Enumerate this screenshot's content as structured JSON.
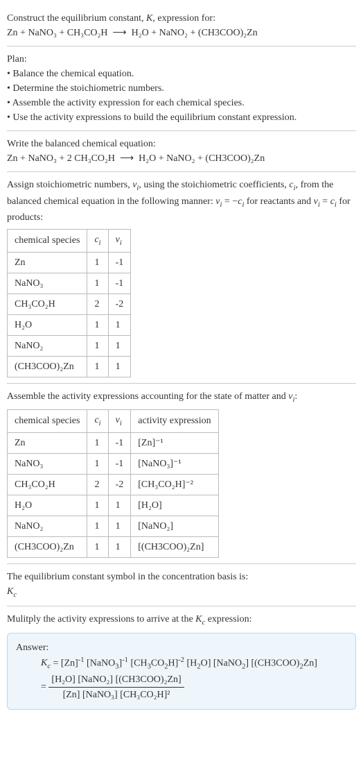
{
  "header": {
    "title_line1": "Construct the equilibrium constant, K, expression for:",
    "equation": "Zn + NaNO₃ + CH₃CO₂H  ⟶  H₂O + NaNO₂ + (CH3COO)₂Zn"
  },
  "plan": {
    "heading": "Plan:",
    "items": [
      "• Balance the chemical equation.",
      "• Determine the stoichiometric numbers.",
      "• Assemble the activity expression for each chemical species.",
      "• Use the activity expressions to build the equilibrium constant expression."
    ]
  },
  "balanced": {
    "heading": "Write the balanced chemical equation:",
    "equation": "Zn + NaNO₃ + 2 CH₃CO₂H  ⟶  H₂O + NaNO₂ + (CH3COO)₂Zn"
  },
  "stoich": {
    "intro": "Assign stoichiometric numbers, νᵢ, using the stoichiometric coefficients, cᵢ, from the balanced chemical equation in the following manner: νᵢ = −cᵢ for reactants and νᵢ = cᵢ for products:",
    "headers": [
      "chemical species",
      "cᵢ",
      "νᵢ"
    ],
    "rows": [
      [
        "Zn",
        "1",
        "-1"
      ],
      [
        "NaNO₃",
        "1",
        "-1"
      ],
      [
        "CH₃CO₂H",
        "2",
        "-2"
      ],
      [
        "H₂O",
        "1",
        "1"
      ],
      [
        "NaNO₂",
        "1",
        "1"
      ],
      [
        "(CH3COO)₂Zn",
        "1",
        "1"
      ]
    ]
  },
  "activity": {
    "intro": "Assemble the activity expressions accounting for the state of matter and νᵢ:",
    "headers": [
      "chemical species",
      "cᵢ",
      "νᵢ",
      "activity expression"
    ],
    "rows": [
      [
        "Zn",
        "1",
        "-1",
        "[Zn]⁻¹"
      ],
      [
        "NaNO₃",
        "1",
        "-1",
        "[NaNO₃]⁻¹"
      ],
      [
        "CH₃CO₂H",
        "2",
        "-2",
        "[CH₃CO₂H]⁻²"
      ],
      [
        "H₂O",
        "1",
        "1",
        "[H₂O]"
      ],
      [
        "NaNO₂",
        "1",
        "1",
        "[NaNO₂]"
      ],
      [
        "(CH3COO)₂Zn",
        "1",
        "1",
        "[(CH3COO)₂Zn]"
      ]
    ]
  },
  "symbol": {
    "line1": "The equilibrium constant symbol in the concentration basis is:",
    "line2": "K_c"
  },
  "multiply": {
    "intro": "Mulitply the activity expressions to arrive at the K_c expression:"
  },
  "answer": {
    "label": "Answer:",
    "line1": "K_c = [Zn]⁻¹ [NaNO₃]⁻¹ [CH₃CO₂H]⁻² [H₂O] [NaNO₂] [(CH3COO)₂Zn]",
    "frac_num": "[H₂O] [NaNO₂] [(CH3COO)₂Zn]",
    "frac_den": "[Zn] [NaNO₃] [CH₃CO₂H]²",
    "equals": "= "
  }
}
